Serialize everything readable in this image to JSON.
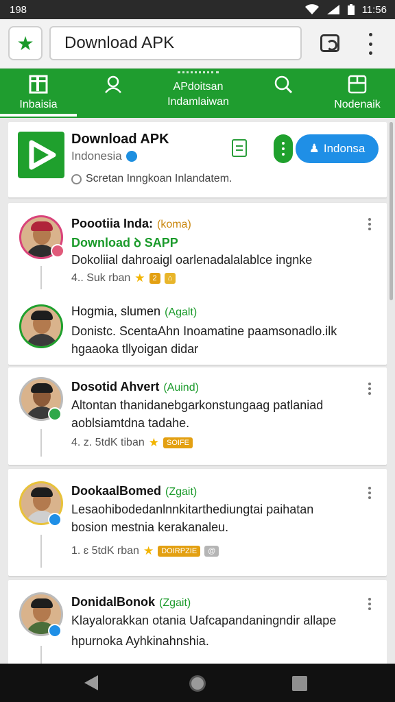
{
  "status_bar": {
    "left_text": "198",
    "time": "11:56",
    "icons": [
      "wifi-icon",
      "signal-icon",
      "battery-icon"
    ]
  },
  "browser": {
    "url_text": "Download APK",
    "icons": [
      "star-icon",
      "tab-switcher-icon",
      "menu-icon"
    ]
  },
  "nav_tabs": [
    {
      "label": "Inbaisia",
      "icon": "home-icon"
    },
    {
      "label": "",
      "icon": "profile-icon"
    },
    {
      "label": "AP̲doitsan\nIndamlaiwan",
      "label_line1": "APdoitsan",
      "label_line2": "Indamlaiwan",
      "icon": ""
    },
    {
      "label": "",
      "icon": "search-icon"
    },
    {
      "label": "Nodenaik",
      "icon": "notes-icon"
    }
  ],
  "app": {
    "title": "Download APK",
    "subtitle": "Indonesia",
    "meta": "Scretan Inngkoan Inlandatem.",
    "install_label": "Indonsa",
    "icon": "play-logo-icon",
    "accent": "#1fa02d",
    "button_color": "#1f8fe6"
  },
  "posts": [
    {
      "name": "Poootiia Inda:",
      "tag": "(koma)",
      "subtitle": "Download ꝺ SAPP",
      "line1": "Dokoliial dahroaigl oarlenadalalablce ingnke",
      "line2": "",
      "meta": "4.⁠. Suk rban",
      "badge_color": "#e05a7a",
      "ring_color": "#d9437a"
    },
    {
      "name": "Hogmia, slumen",
      "tag": "(Agalt)",
      "subtitle": "",
      "line1": "Donistc. ScentaAhn Inoamatine paamsonadlo.ilk",
      "line2": "hgaaoka tllyoigan didar",
      "meta": "",
      "badge_color": "",
      "ring_color": "#1fa02d"
    },
    {
      "name": "Dosotid Ahvert",
      "tag": "(Auind)",
      "subtitle": "",
      "line1": "Altontan thanidanebgarkonstungaag patlaniad",
      "line2": "aoblsiamtdna tadahe.",
      "meta": "4. z. 5tdK tiban",
      "pill": "SOIFE",
      "badge_color": "#2fa84a",
      "ring_color": "#bbbbbb"
    },
    {
      "name": "DookaalBomed",
      "tag": "(Zgait)",
      "subtitle": "",
      "line1": "Lesaohibodedanlnnkitarthediungtai paihatan",
      "line2": "bosion mestnia kerakanaleu.",
      "meta": "1. ɛ 5tdK rban",
      "pill": "DOIRPZIE",
      "badge_color": "#1f8fe6",
      "ring_color": "#e8c23a"
    },
    {
      "name": "DonidalBonok",
      "tag": "(Zgait)",
      "subtitle": "",
      "line1": "Klayalorakkan otania Uafcapandaningndir allape",
      "line2": "hpurnoka Ayhkinahnshia.",
      "meta": "",
      "badge_color": "#1f8fe6",
      "ring_color": "#bbbbbb"
    }
  ],
  "system_nav": {
    "icons": [
      "back-icon",
      "home-icon",
      "recents-icon"
    ]
  }
}
